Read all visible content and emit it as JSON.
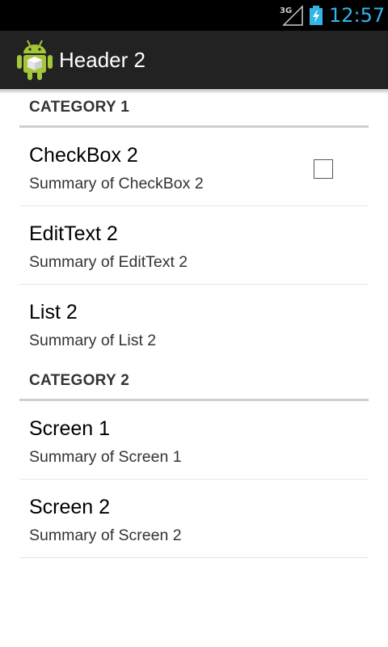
{
  "status_bar": {
    "network": "3G",
    "time": "12:57",
    "colors": {
      "accent": "#33b5e5"
    }
  },
  "action_bar": {
    "title": "Header 2",
    "icon": "android-app-icon"
  },
  "categories": [
    {
      "label": "CATEGORY 1",
      "items": [
        {
          "title": "CheckBox 2",
          "summary": "Summary of CheckBox 2",
          "widget": "checkbox",
          "checked": false
        },
        {
          "title": "EditText 2",
          "summary": "Summary of EditText 2"
        },
        {
          "title": "List 2",
          "summary": "Summary of List 2"
        }
      ]
    },
    {
      "label": "CATEGORY 2",
      "items": [
        {
          "title": "Screen 1",
          "summary": "Summary of Screen 1"
        },
        {
          "title": "Screen 2",
          "summary": "Summary of Screen 2"
        }
      ]
    }
  ]
}
